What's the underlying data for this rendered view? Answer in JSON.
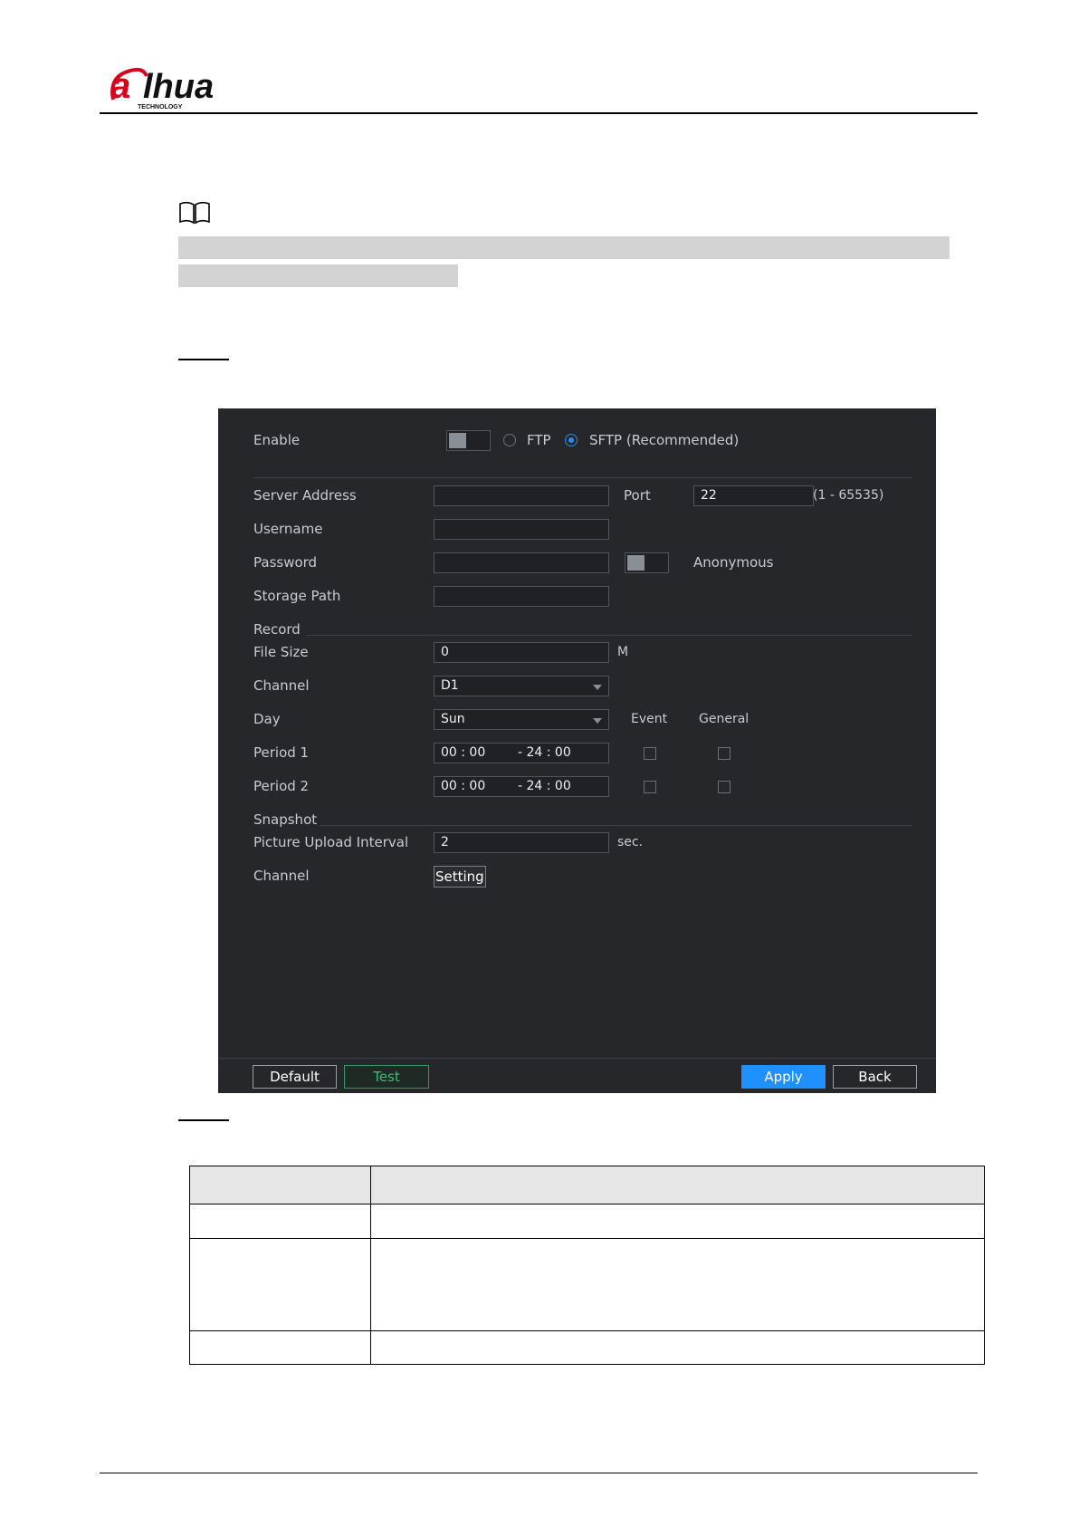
{
  "brand": {
    "logo_text": "alhua",
    "logo_subtext": "TECHNOLOGY",
    "accent": "#d9001b"
  },
  "dialog": {
    "enable_label": "Enable",
    "protocol_ftp": "FTP",
    "protocol_sftp": "SFTP (Recommended)",
    "protocol_selected": "SFTP",
    "server_address_label": "Server Address",
    "server_address_value": "",
    "port_label": "Port",
    "port_value": "22",
    "port_range": "(1 - 65535)",
    "username_label": "Username",
    "username_value": "",
    "password_label": "Password",
    "password_value": "",
    "anonymous_label": "Anonymous",
    "storage_path_label": "Storage Path",
    "storage_path_value": "",
    "record_section": "Record",
    "file_size_label": "File Size",
    "file_size_value": "0",
    "file_size_unit": "M",
    "channel_label": "Channel",
    "channel_value": "D1",
    "day_label": "Day",
    "day_value": "Sun",
    "event_header": "Event",
    "general_header": "General",
    "periods": [
      {
        "label": "Period 1",
        "start": "00 : 00",
        "end": "- 24 : 00",
        "event": false,
        "general": false
      },
      {
        "label": "Period 2",
        "start": "00 : 00",
        "end": "- 24 : 00",
        "event": false,
        "general": false
      }
    ],
    "snapshot_section": "Snapshot",
    "upload_interval_label": "Picture Upload Interval",
    "upload_interval_value": "2",
    "upload_interval_unit": "sec.",
    "snapshot_channel_label": "Channel",
    "setting_button": "Setting",
    "buttons": {
      "default": "Default",
      "test": "Test",
      "apply": "Apply",
      "back": "Back"
    },
    "colors": {
      "background": "#25272b",
      "apply": "#1e90ff",
      "test": "#42b97a"
    }
  }
}
